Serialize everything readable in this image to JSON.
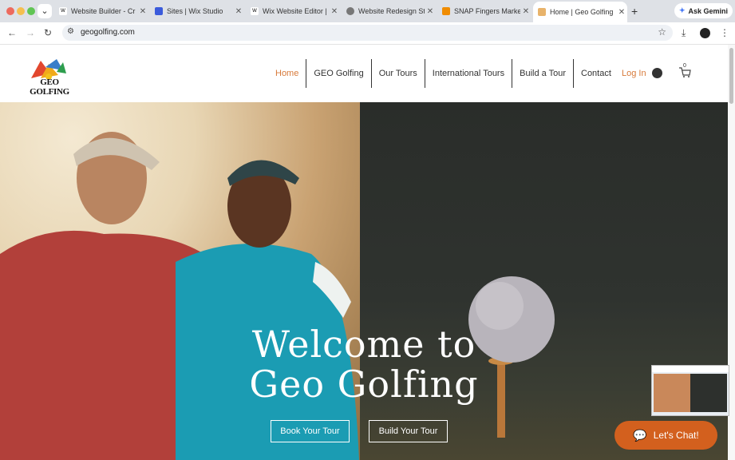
{
  "browser": {
    "tabs": [
      {
        "label": "Website Builder - Cr",
        "active": false
      },
      {
        "label": "Sites | Wix Studio",
        "active": false
      },
      {
        "label": "Wix Website Editor |",
        "active": false
      },
      {
        "label": "Website Redesign St",
        "active": false
      },
      {
        "label": "SNAP Fingers Marke",
        "active": false
      },
      {
        "label": "Home | Geo Golfing",
        "active": true
      }
    ],
    "new_tab": "+",
    "gemini_label": "Ask Gemini",
    "url": "geogolfing.com",
    "colors": {
      "tabbar": "#dee1e6",
      "omnibox": "#eef1f5"
    }
  },
  "site": {
    "logo_text": "GEO GOLFING",
    "nav": [
      "Home",
      "GEO Golfing",
      "Our Tours",
      "International Tours",
      "Build a Tour",
      "Contact"
    ],
    "login_label": "Log In",
    "cart_count": "0",
    "accent": "#d87a3a"
  },
  "hero": {
    "title_line1": "Welcome to",
    "title_line2": "Geo Golfing",
    "book_button": "Book Your Tour",
    "build_button": "Build Your Tour"
  },
  "chat": {
    "label": "Let's Chat!",
    "color": "#d3601e"
  }
}
